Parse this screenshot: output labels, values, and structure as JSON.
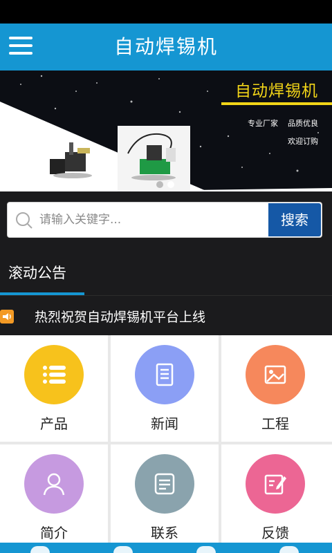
{
  "app": {
    "title": "自动焊锡机",
    "accent": "#1596d2"
  },
  "banner": {
    "title": "自动焊锡机",
    "tag1": "专业厂家",
    "tag2": "品质优良",
    "tag3": "欢迎订购",
    "accent": "#f2d518"
  },
  "search": {
    "placeholder": "请输入关键字...",
    "button_label": "搜索"
  },
  "notice": {
    "header": "滚动公告",
    "message": "热烈祝贺自动焊锡机平台上线"
  },
  "grid": {
    "items": [
      {
        "label": "产品",
        "icon": "list-icon",
        "color": "#f7c21c"
      },
      {
        "label": "新闻",
        "icon": "document-icon",
        "color": "#8b9ff5"
      },
      {
        "label": "工程",
        "icon": "image-icon",
        "color": "#f6885c"
      },
      {
        "label": "简介",
        "icon": "user-icon",
        "color": "#c69ae0"
      },
      {
        "label": "联系",
        "icon": "contact-card-icon",
        "color": "#8aa3ad"
      },
      {
        "label": "反馈",
        "icon": "edit-icon",
        "color": "#ec6694"
      }
    ]
  }
}
